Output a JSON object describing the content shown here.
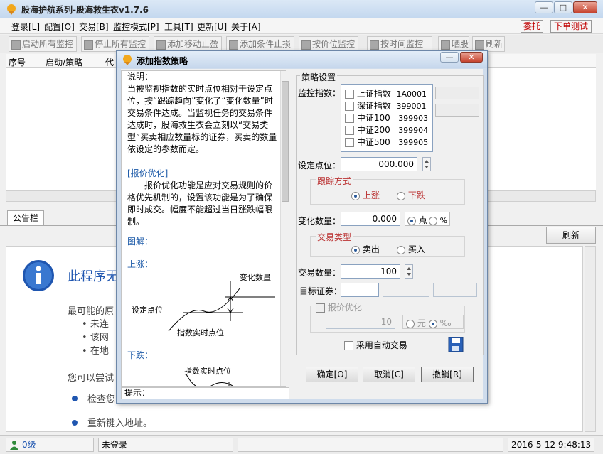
{
  "window": {
    "title": "股海护航系列-股海救生衣v1.7.6",
    "min": "—",
    "max": "□",
    "close": "✕"
  },
  "menu": {
    "items": [
      "登录[L]",
      "配置[O]",
      "交易[B]",
      "监控模式[P]",
      "工具[T]",
      "更新[U]",
      "关于[A]"
    ],
    "entrust": "委托",
    "order_test": "下单测试"
  },
  "toolbar": [
    "启动所有监控",
    "停止所有监控",
    "添加移动止盈",
    "添加条件止损",
    "按价位监控",
    "按时间监控",
    "晒股",
    "刷新"
  ],
  "grid": {
    "columns": [
      "序号",
      "启动/策略",
      "代"
    ]
  },
  "tabs": {
    "notice": "公告栏",
    "refresh": "刷新"
  },
  "notice": {
    "heading": "此程序无",
    "reason_title": "最可能的原",
    "bullets": [
      "未连",
      "该网",
      "在地"
    ],
    "try_text": "您可以尝试",
    "actions": [
      "检查您",
      "重新键入地址。"
    ]
  },
  "status": {
    "level": "0级",
    "login": "未登录",
    "datetime": "2016-5-12  9:48:13"
  },
  "dialog": {
    "title": "添加指数策略",
    "help": {
      "head": "说明：",
      "p1": "当被监视指数的实时点位相对于设定点位，按“跟踪趋向”变化了“变化数量”时交易条件达成。当监视任务的交易条件达成时，股海救生衣会立刻以“交易类型”买卖相应数量标的证券，买卖的数量依设定的参数而定。",
      "opt_title": "[报价优化]",
      "p2": "报价优化功能是应对交易规则的价格优先机制的，设置该功能是为了确保即时成交。幅度不能超过当日涨跌幅限制。",
      "diagram": "图解：",
      "up": "上涨：",
      "down": "下跌：",
      "d_change": "变化数量",
      "d_set": "设定点位",
      "d_real": "指数实时点位"
    },
    "tip": "提示：",
    "strategy": {
      "group": "策略设置",
      "monitor_label": "监控指数：",
      "indices": [
        {
          "name": "上证指数",
          "code": "1A0001"
        },
        {
          "name": "深证指数",
          "code": "399001"
        },
        {
          "name": "中证100",
          "code": "399903"
        },
        {
          "name": "中证200",
          "code": "399904"
        },
        {
          "name": "中证500",
          "code": "399905"
        }
      ],
      "set_point_label": "设定点位：",
      "set_point_value": "000.000",
      "track_group": "跟踪方式",
      "track_up": "上涨",
      "track_down": "下跌",
      "change_label": "变化数量：",
      "change_value": "0.000",
      "unit_point": "点",
      "unit_pct": "%",
      "trade_group": "交易类型",
      "sell": "卖出",
      "buy": "买入",
      "qty_label": "交易数量：",
      "qty_value": "100",
      "target_label": "目标证券：",
      "price_opt": "报价优化",
      "price_opt_value": "10",
      "yuan": "元",
      "permille": "‰",
      "auto_trade": "采用自动交易"
    },
    "buttons": {
      "ok": "确定[O]",
      "cancel": "取消[C]",
      "undo": "撤销[R]"
    }
  },
  "colors": {
    "title_gradient_top": "#dbe8f6",
    "red_text": "#c00000",
    "info_blue": "#1f56b0",
    "dialog_frame": "#cfdcec"
  }
}
